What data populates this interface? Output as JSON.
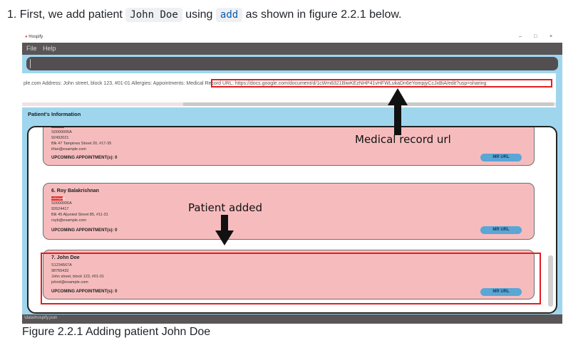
{
  "doc": {
    "step_prefix": "1. First, we add patient",
    "code1": "John Doe",
    "mid": "using",
    "code2": "add",
    "suffix": "as shown in figure 2.2.1 below.",
    "caption": "Figure 2.2.1 Adding patient John Doe"
  },
  "app": {
    "title": "Hospify",
    "menu": [
      "File",
      "Help"
    ],
    "result_prefix": "ple.com Address: John street, block 123, #01-01 Allergies:  Appointments:",
    "result_url": "Medical Record URL: https://docs.google.com/document/d/1cWm8321BiwKEzNHP41vHFWLukaDn6eYompjyCcJxBiA/edit?usp=sharing",
    "section_title": "Patient's Information",
    "status_path": "\\data\\hospify.json",
    "patients": [
      {
        "name": "",
        "tag": "",
        "lines": [
          "S0000005A",
          "92492021",
          "Blk 47 Tampines Street 20, #17-35",
          "irfan@example.com"
        ],
        "appt": "UPCOMING APPOINTMENT(s): 0",
        "mr": "MR URL"
      },
      {
        "name": "6.  Roy Balakrishnan",
        "tag": "colleagues",
        "lines": [
          "S0000006A",
          "92624417",
          "Blk 45 Aljunied Street 85, #11-31",
          "royb@example.com"
        ],
        "appt": "UPCOMING APPOINTMENT(s): 0",
        "mr": "MR URL"
      },
      {
        "name": "7.  John Doe",
        "tag": "",
        "lines": [
          "S1234567A",
          "98765432",
          "John street, block 123, #01-01",
          "johnd@example.com"
        ],
        "appt": "UPCOMING APPOINTMENT(s): 0",
        "mr": "MR URL"
      }
    ]
  },
  "annotations": {
    "medical_record": "Medical record url",
    "patient_added": "Patient added"
  },
  "colors": {
    "highlight": "#e41e1e",
    "card": "#f6bcbd",
    "background": "#9fd6ee",
    "mr_button": "#5aa6d6"
  }
}
